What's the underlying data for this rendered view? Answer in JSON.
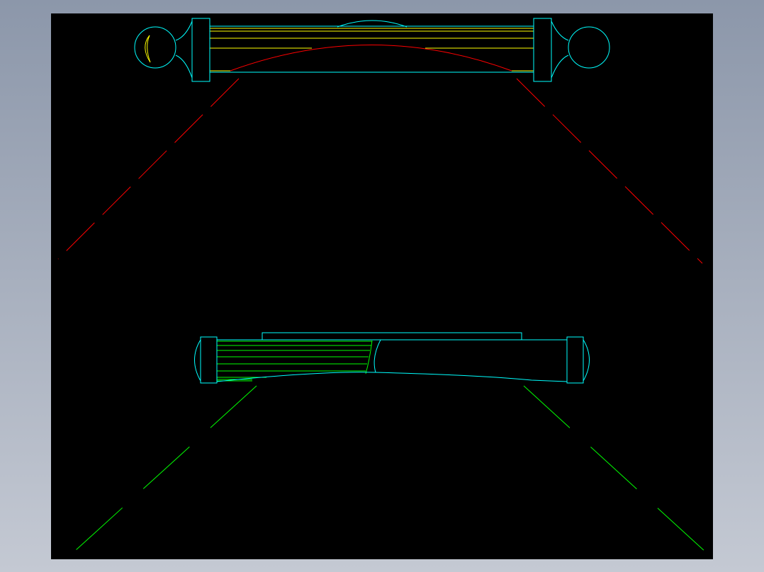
{
  "viewer": {
    "background_top": "#8c97aa",
    "background_bottom": "#c4c9d3",
    "canvas_color": "#000000"
  },
  "colors": {
    "outline": "#00ffff",
    "detail": "#ffff00",
    "arc": "#ff0000",
    "hatch": "#00ff00"
  },
  "line_styles": {
    "top_view_guides": "dashed",
    "bottom_view_guides": "dashed"
  }
}
